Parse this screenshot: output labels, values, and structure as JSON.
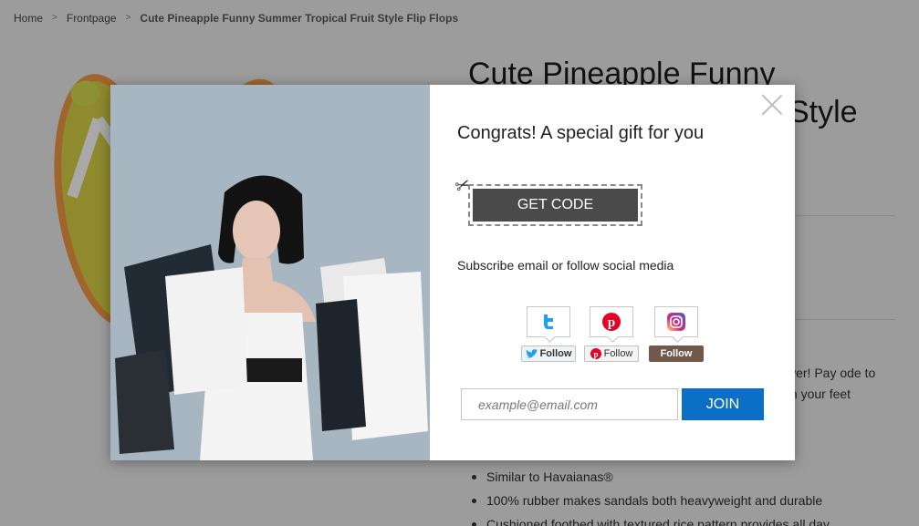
{
  "breadcrumb": {
    "home": "Home",
    "frontpage": "Frontpage",
    "current": "Cute Pineapple Funny Summer Tropical Fruit Style Flip Flops",
    "separator": ">"
  },
  "product": {
    "title_line1": "Cute Pineapple Funny",
    "title_line2": "Style",
    "desc_line1": "swer! Pay ode to",
    "desc_line2": "th your feet",
    "bullets": [
      "Similar to Havaianas®",
      "100% rubber makes sandals both heavyweight and durable",
      "Cushioned footbed with textured rice pattern provides all day"
    ]
  },
  "modal": {
    "title": "Congrats! A special gift for you",
    "get_code_label": "GET CODE",
    "subscribe_text": "Subscribe email or follow social media",
    "social": [
      {
        "network": "twitter",
        "icon": "twitter-icon",
        "follow_label": "Follow",
        "color": "#1da1f2"
      },
      {
        "network": "pinterest",
        "icon": "pinterest-icon",
        "follow_label": "Follow",
        "color": "#e60023"
      },
      {
        "network": "instagram",
        "icon": "instagram-icon",
        "follow_label": "Follow",
        "color": "#c13584"
      }
    ],
    "email_placeholder": "example@email.com",
    "join_label": "JOIN",
    "join_color": "#0b6fc6"
  }
}
